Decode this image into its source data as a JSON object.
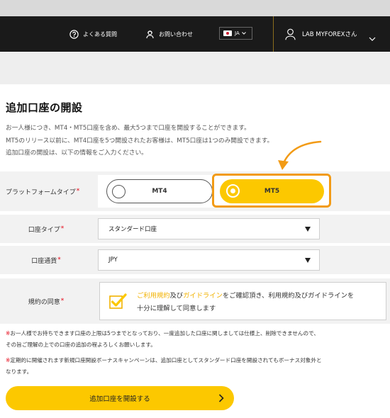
{
  "header": {
    "faq_label": "よくある質問",
    "contact_label": "お問い合わせ",
    "language": "JA",
    "user_name": "LAB MYFOREXさん"
  },
  "page": {
    "title": "追加口座の開設",
    "intro_lines": [
      "お一人様につき、MT4・MT5口座を含め、最大5つまで口座を開設することができます。",
      "MT5のリリース以前に、MT4口座を5つ開設されたお客様は、MT5口座は1つのみ開設できます。",
      "追加口座の開設は、以下の情報をご入力ください。"
    ]
  },
  "form": {
    "platform": {
      "label": "プラットフォームタイプ",
      "required_mark": "*",
      "options": [
        "MT4",
        "MT5"
      ],
      "selected": "MT5"
    },
    "account_type": {
      "label": "口座タイプ",
      "required_mark": "*",
      "value": "スタンダード口座"
    },
    "currency": {
      "label": "口座通貨",
      "required_mark": "*",
      "value": "JPY"
    },
    "terms": {
      "label": "規約の同意",
      "required_mark": "*",
      "checked": true,
      "link_terms": "ご利用規約",
      "and_text": "及び",
      "link_guidelines": "ガイドライン",
      "line1_rest": "をご確認頂き、利用規約及びガイドラインを",
      "line2": "十分に理解して同意します"
    }
  },
  "notes": [
    {
      "mark": "※",
      "lines": [
        "お一人様でお持ちできます口座の上限は5つまでとなっており、一度追加した口座に関しましては仕様上、削除できませんので、",
        "その旨ご理解の上での口座の追加の程よろしくお願いします。"
      ]
    },
    {
      "mark": "※",
      "lines": [
        "定期的に開催されます新規口座開設ボーナスキャンペーンは、追加口座としてスタンダード口座を開設されてもボーナス対象外と",
        "なります。"
      ]
    }
  ],
  "submit_label": "追加口座を開設する",
  "colors": {
    "accent": "#fcc800",
    "highlight": "#f29b16",
    "required": "#e60012",
    "header_bg": "#1a1a1a"
  }
}
